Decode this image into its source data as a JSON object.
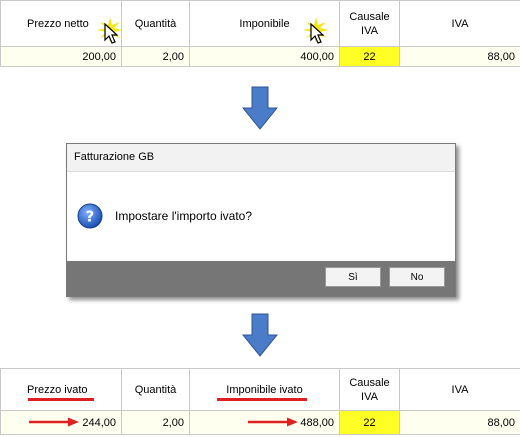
{
  "top_table": {
    "headers": {
      "prezzo": "Prezzo netto",
      "quantita": "Quantità",
      "imponibile": "Imponibile",
      "causale": "Causale IVA",
      "iva": "IVA"
    },
    "row": {
      "prezzo": "200,00",
      "quantita": "2,00",
      "imponibile": "400,00",
      "causale": "22",
      "iva": "88,00"
    }
  },
  "dialog": {
    "title": "Fatturazione GB",
    "message": "Impostare l'importo ivato?",
    "yes_label": "Sì",
    "no_label": "No"
  },
  "bottom_table": {
    "headers": {
      "prezzo": "Prezzo ivato",
      "quantita": "Quantità",
      "imponibile": "Imponibile ivato",
      "causale": "Causale IVA",
      "iva": "IVA"
    },
    "row": {
      "prezzo": "244,00",
      "quantita": "2,00",
      "imponibile": "488,00",
      "causale": "22",
      "iva": "88,00"
    }
  },
  "colors": {
    "causale_fill": "#ffff26",
    "row_fill": "#fffff0",
    "arrow_blue": "#3f6fbf",
    "highlight_red": "#e02020",
    "dialog_footer": "#767676"
  },
  "icons": [
    "cursor-click-icon",
    "down-arrow-icon",
    "question-icon",
    "red-arrow-icon"
  ]
}
